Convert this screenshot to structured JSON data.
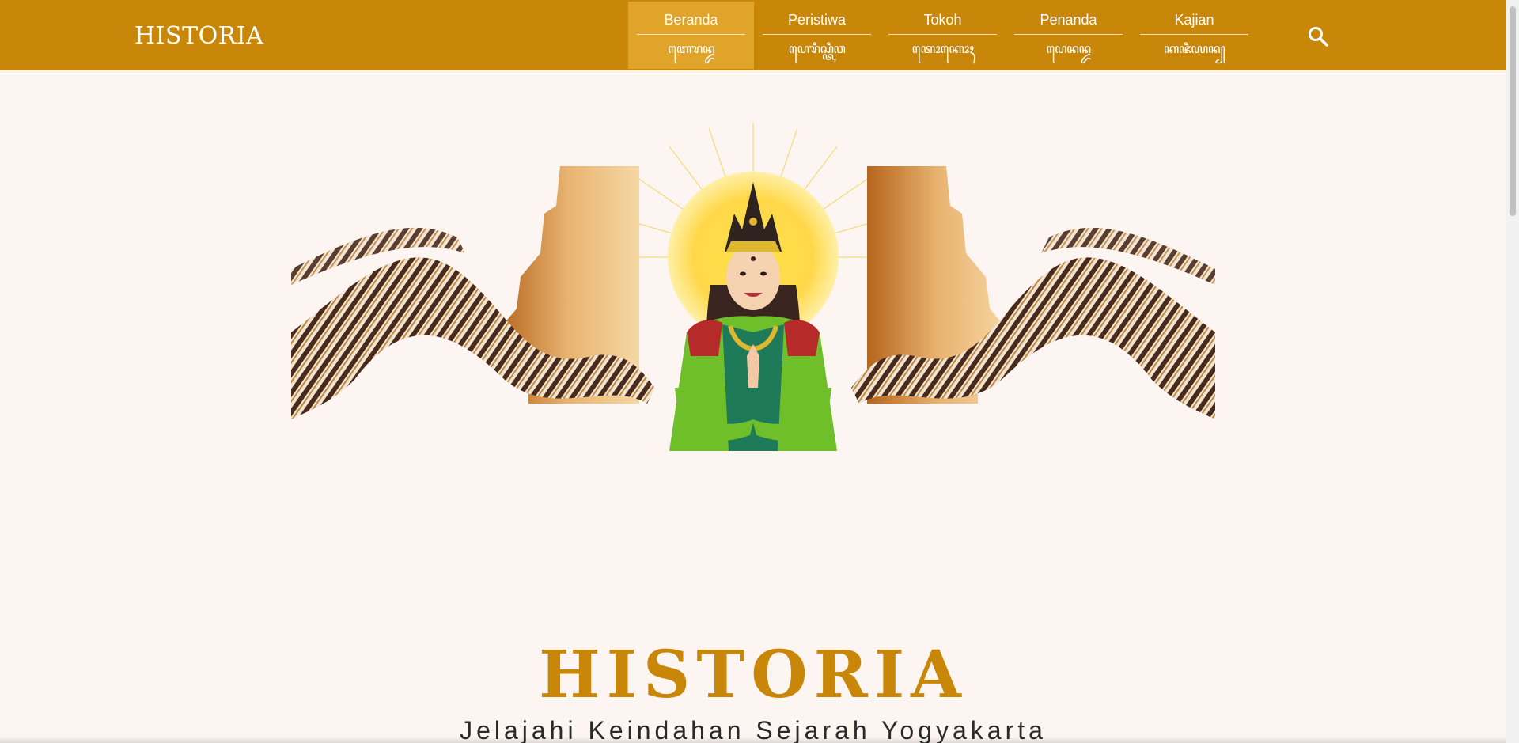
{
  "header": {
    "brand": "HISTORIA",
    "nav": [
      {
        "label": "Beranda",
        "script": "ꦧꦺꦫꦤ꧀ꦢ",
        "active": true
      },
      {
        "label": "Peristiwa",
        "script": "ꦥꦺꦫꦶꦱ꧀ꦠꦶꦮ",
        "active": false
      },
      {
        "label": "Tokoh",
        "script": "ꦠꦺꦴꦏꦺꦴꦃ",
        "active": false
      },
      {
        "label": "Penanda",
        "script": "ꦥꦺꦤꦤ꧀ꦢ",
        "active": false
      },
      {
        "label": "Kajian",
        "script": "ꦏꦗꦶꦪꦤ꧀",
        "active": false
      }
    ],
    "search_icon": "search-icon"
  },
  "hero": {
    "title": "HISTORIA",
    "subtitle": "Jelajahi Keindahan Sejarah Yogyakarta"
  },
  "colors": {
    "header_bg": "#c9870a",
    "active_tab": "#e1a42a",
    "page_bg": "#fdf5f1",
    "accent": "#c9870a"
  }
}
